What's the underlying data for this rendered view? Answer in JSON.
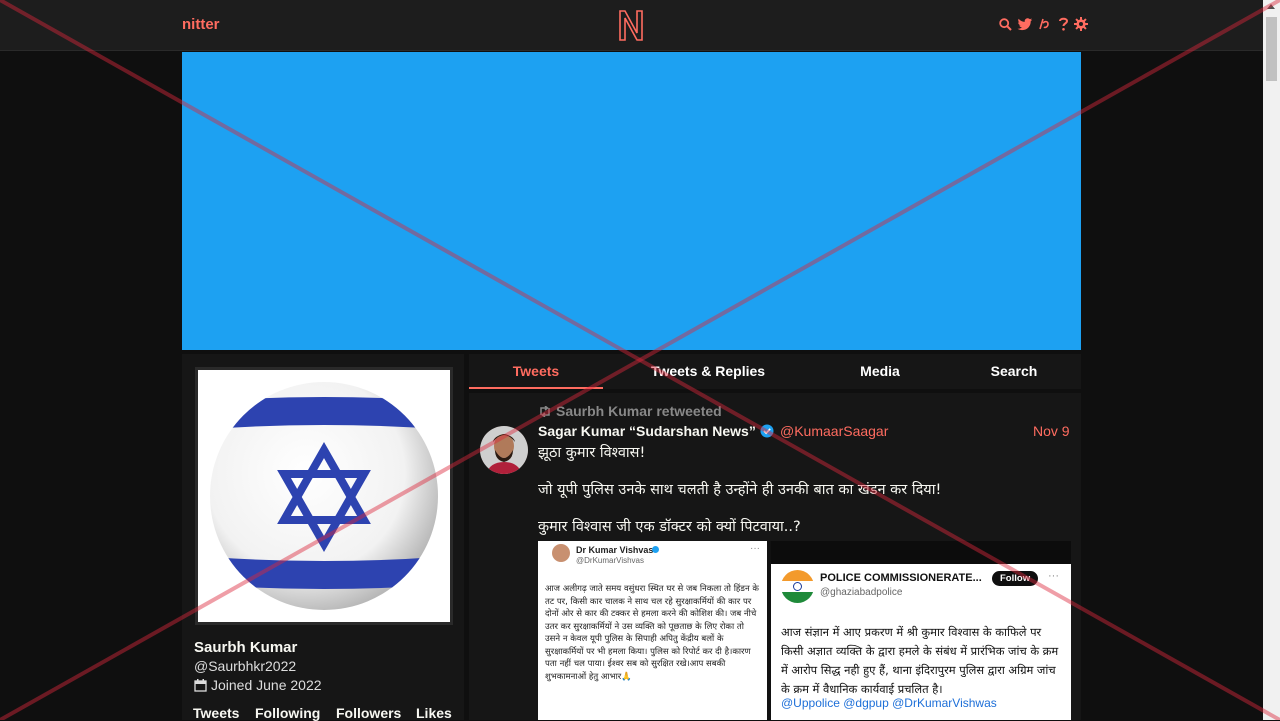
{
  "nav": {
    "brand": "nitter",
    "icons": [
      "search-icon",
      "twitter-icon",
      "rss-icon",
      "help-icon",
      "gear-icon"
    ]
  },
  "colors": {
    "accent": "#ff6c60",
    "banner": "#1da1f2",
    "background": "#0f0f0f",
    "panel": "#161616"
  },
  "profile": {
    "fullname": "Saurbh Kumar",
    "username": "@Saurbhkr2022",
    "joined": "Joined June 2022",
    "stats": [
      "Tweets",
      "Following",
      "Followers",
      "Likes"
    ]
  },
  "tabs": [
    "Tweets",
    "Tweets & Replies",
    "Media",
    "Search"
  ],
  "tweet": {
    "retweet_header": "Saurbh Kumar retweeted",
    "author_name": "Sagar Kumar “Sudarshan News”",
    "author_handle": "@KumaarSaagar",
    "date": "Nov 9",
    "paragraphs": [
      "झूठा कुमार विश्वास!",
      "जो यूपी पुलिस उनके साथ चलती है उन्होंने ही उनकी बात का खंडन कर दिया!",
      "कुमार विश्वास जी एक डॉक्टर को क्यों पिटवाया..?"
    ],
    "embed1": {
      "name": "Dr Kumar Vishvas",
      "handle": "@DrKumarVishvas",
      "text": "आज अलीगढ़ जाते समय वसुंधरा स्थित घर से जब निकला तो हिंडन के तट पर, किसी कार चालक ने साथ चल रहे सुरक्षाकर्मियों की कार पर दोनों ओर से कार की टक्कर से हमला करने की कोशिश की। जब नीचे उतर कर सुरक्षाकर्मियों ने उस व्यक्ति को पूछताछ के लिए रोका तो उसने न केवल यूपी पुलिस के सिपाही अपितु केंद्रीय बलों के सुरक्षाकर्मियों पर भी हमला किया। पुलिस को रिपोर्ट कर दी है।कारण पता नहीं चल पाया। ईश्वर सब को सुरक्षित रखे।आप सबकी शुभकामनाओं हेतु आभार🙏"
    },
    "embed2": {
      "name": "POLICE COMMISSIONERATE...",
      "handle": "@ghaziabadpolice",
      "follow": "Follow",
      "text": "आज संज्ञान में आए प्रकरण में श्री कुमार विश्वास के काफिले पर किसी अज्ञात व्यक्ति के द्वारा हमले के संबंध में प्रारंभिक जांच के क्रम में आरोप सिद्ध नही हुए हैं, थाना इंदिरापुरम पुलिस द्वारा अग्रिम जांच के क्रम में वैधानिक कार्यवाई प्रचलित है।",
      "mentions": "@Uppolice @dgpup @DrKumarVishwas"
    }
  }
}
